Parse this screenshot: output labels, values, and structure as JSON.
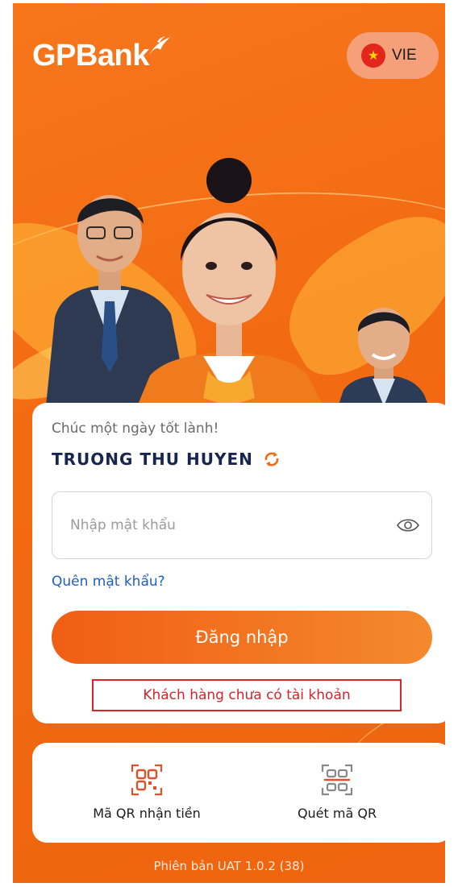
{
  "brand": {
    "logo_text": "GPBank",
    "primary_color": "#f26a12",
    "accent_blue": "#1f5fbf",
    "name_color": "#17254f"
  },
  "language": {
    "label": "VIE",
    "flag_icon": "vietnam-flag-icon"
  },
  "login": {
    "greeting": "Chúc một ngày tốt lành!",
    "user_name": "TRUONG THU HUYEN",
    "switch_user_icon": "refresh-icon",
    "password_placeholder": "Nhập mật khẩu",
    "password_value": "",
    "show_password_icon": "eye-icon",
    "forgot_password": "Quên mật khẩu?",
    "login_button": "Đăng nhập",
    "no_account_link": "Khách hàng chưa có tài khoản"
  },
  "quick_actions": [
    {
      "label": "Mã QR nhận tiền",
      "icon": "qr-code-icon"
    },
    {
      "label": "Quét mã QR",
      "icon": "qr-scan-icon"
    }
  ],
  "footer": {
    "version": "Phiên bản UAT 1.0.2 (38)"
  }
}
